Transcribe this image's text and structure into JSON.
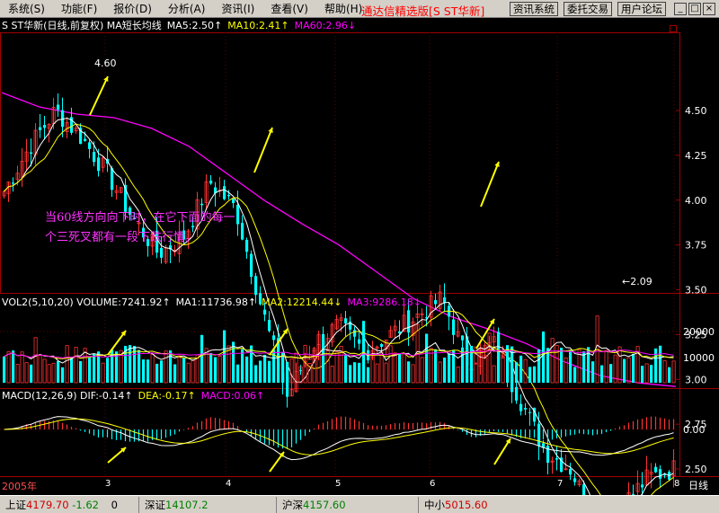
{
  "menu": [
    "系统(S)",
    "功能(F)",
    "报价(D)",
    "分析(A)",
    "资讯(I)",
    "查看(V)",
    "帮助(H)"
  ],
  "brand": "通达信精选版[S ST华新]",
  "toolbar": {
    "news": "资讯系统",
    "trade": "委托交易",
    "forum": "用户论坛"
  },
  "price_panel": {
    "title": "S ST华新(日线,前复权) MA短长均线",
    "ma5": "MA5:2.50↑",
    "ma10": "MA10:2.41↑",
    "ma60": "MA60:2.96↓",
    "high_label": "4.60",
    "low_label": "←2.09",
    "yticks": [
      "4.50",
      "4.25",
      "4.00",
      "3.75",
      "3.50",
      "3.25",
      "3.00",
      "2.75",
      "2.50"
    ]
  },
  "vol_panel": {
    "title": "VOL2(5,10,20) VOLUME:7241.92↑",
    "ma1": "MA1:11736.98↑",
    "ma2": "MA2:12214.44↓",
    "ma3": "MA3:9286.18↓",
    "yticks": [
      "20000",
      "10000"
    ]
  },
  "macd_panel": {
    "title": "MACD(12,26,9) DIF:-0.14↑",
    "dea": "DEA:-0.17↑",
    "macd": "MACD:0.06↑",
    "yticks": [
      "0.00"
    ]
  },
  "annotation": [
    "当60线方向向下时，在它下面的每一",
    "个三死叉都有一段下跌行情。"
  ],
  "xaxis": {
    "date": "2005年",
    "marks": [
      "3",
      "4",
      "5",
      "6",
      "7",
      "8"
    ],
    "period": "日线"
  },
  "status": {
    "sh_label": "上证",
    "sh_value": "4179.70",
    "sh_change": "-1.62",
    "sh_extra": "0",
    "sz_label": "深证",
    "sz_value": "14107.2",
    "hs_label": "沪深",
    "hs_value": "4157.60",
    "zx_label": "中小",
    "zx_value": "5015.60"
  },
  "colors": {
    "up": "#ff3232",
    "down": "#00ffff",
    "ma5": "#ffffff",
    "ma10": "#ffff00",
    "ma60": "#ff00ff",
    "grid": "#a00000"
  },
  "chart_data": {
    "type": "candlestick",
    "ma60": [
      4.6,
      4.52,
      4.48,
      4.46,
      4.4,
      4.3,
      4.15,
      4.0,
      3.87,
      3.75,
      3.6,
      3.45,
      3.35,
      3.28,
      3.2,
      3.1,
      3.02,
      2.98,
      2.96
    ],
    "close": [
      4.05,
      4.3,
      4.5,
      4.35,
      4.15,
      3.9,
      3.7,
      3.8,
      4.1,
      3.95,
      3.4,
      2.9,
      3.2,
      3.3,
      3.15,
      3.25,
      3.35,
      3.45,
      3.1,
      3.2,
      2.9,
      2.6,
      2.5,
      2.2,
      2.3,
      2.45,
      2.5
    ]
  }
}
